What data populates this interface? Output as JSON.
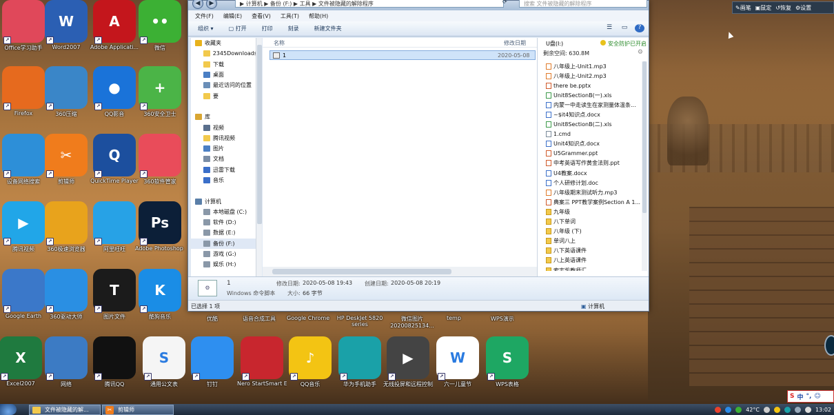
{
  "float_toolbar": {
    "items": [
      "画笔",
      "鼠定",
      "恢复",
      "设置"
    ]
  },
  "desktop_icons": [
    {
      "id": "d1",
      "label": "Office学习助手",
      "icon": "pink-circle-icon",
      "color": "#e0485a",
      "text": ""
    },
    {
      "id": "d2",
      "label": "Word2007",
      "icon": "word-icon",
      "color": "#2b5fb3",
      "text": "W"
    },
    {
      "id": "d3",
      "label": "Adobe Applicati...",
      "icon": "adobe-icon",
      "color": "#c4161c",
      "text": "A"
    },
    {
      "id": "d4",
      "label": "微信",
      "icon": "wechat-icon",
      "color": "#3cb034",
      "text": "••"
    },
    {
      "id": "d5",
      "label": "Firefox",
      "icon": "firefox-icon",
      "color": "#e66a1e",
      "text": ""
    },
    {
      "id": "d6",
      "label": "360压缩",
      "icon": "zip-icon",
      "color": "#3a86c8",
      "text": ""
    },
    {
      "id": "d7",
      "label": "QQ影音",
      "icon": "qq-player-icon",
      "color": "#1a73d9",
      "text": "●"
    },
    {
      "id": "d8",
      "label": "360安全卫士",
      "icon": "360-guard-icon",
      "color": "#4bb447",
      "text": "+"
    },
    {
      "id": "d9",
      "label": "设备网络搜索",
      "icon": "device-search-icon",
      "color": "#2d8fd8",
      "text": ""
    },
    {
      "id": "d10",
      "label": "剪辑师",
      "icon": "scissors-icon",
      "color": "#f07c1c",
      "text": "✂"
    },
    {
      "id": "d11",
      "label": "QuickTime Player",
      "icon": "quicktime-icon",
      "color": "#1c4f9e",
      "text": "Q"
    },
    {
      "id": "d12",
      "label": "360软件管家",
      "icon": "360-software-icon",
      "color": "#e94c5a",
      "text": ""
    },
    {
      "id": "d13",
      "label": "腾讯视频",
      "icon": "tencent-video-icon",
      "color": "#21a6e8",
      "text": "▶"
    },
    {
      "id": "d14",
      "label": "360极速浏览器",
      "icon": "360-browser-icon",
      "color": "#e8a31c",
      "text": ""
    },
    {
      "id": "d15",
      "label": "阿里旺旺",
      "icon": "wangwang-icon",
      "color": "#27a2e6",
      "text": ""
    },
    {
      "id": "d16",
      "label": "Adobe Photoshop ...",
      "icon": "photoshop-icon",
      "color": "#0c1f38",
      "text": "Ps"
    },
    {
      "id": "d17",
      "label": "Google Earth",
      "icon": "google-earth-icon",
      "color": "#3b78c9",
      "text": ""
    },
    {
      "id": "d18",
      "label": "360驱动大师",
      "icon": "driver-icon",
      "color": "#2a8fe3",
      "text": ""
    },
    {
      "id": "d19",
      "label": "图片文件",
      "icon": "t-icon",
      "color": "#1b1b1b",
      "text": "T"
    },
    {
      "id": "d20",
      "label": "酷狗音乐",
      "icon": "kugou-icon",
      "color": "#1a8de6",
      "text": "K"
    }
  ],
  "mid_captions": [
    "优酷",
    "语音合成工具",
    "Google Chrome",
    "HP DeskJet 5820 series",
    "微信图片 20200825134...",
    "temp",
    "WPS演示"
  ],
  "bottom_icons": [
    {
      "id": "b1",
      "label": "Excel2007",
      "icon": "excel-icon",
      "color": "#1f7a3f",
      "text": "X"
    },
    {
      "id": "b2",
      "label": "网络",
      "icon": "network-icon",
      "color": "#3c7bc4",
      "text": ""
    },
    {
      "id": "b3",
      "label": "腾讯QQ",
      "icon": "qq-icon",
      "color": "#111111",
      "text": ""
    },
    {
      "id": "b4",
      "label": "通用公文表",
      "icon": "wps-sheet-icon",
      "color": "#f5f5f5",
      "text": "S"
    },
    {
      "id": "b5",
      "label": "钉钉",
      "icon": "dingtalk-icon",
      "color": "#2e8ff0",
      "text": ""
    },
    {
      "id": "b6",
      "label": "Nero StartSmart Essentials",
      "icon": "nero-icon",
      "color": "#c8262e",
      "text": ""
    },
    {
      "id": "b7",
      "label": "QQ音乐",
      "icon": "qq-music-icon",
      "color": "#f3c413",
      "text": "♪"
    },
    {
      "id": "b8",
      "label": "华为手机助手",
      "icon": "huawei-assistant-icon",
      "color": "#1aa1a8",
      "text": ""
    },
    {
      "id": "b9",
      "label": "无线投屏和远程控制的APP的...",
      "icon": "cast-icon",
      "color": "#444444",
      "text": "▶"
    },
    {
      "id": "b10",
      "label": "六一儿童节",
      "icon": "wps-doc-icon",
      "color": "#ffffff",
      "text": "W"
    },
    {
      "id": "b11",
      "label": "WPS表格",
      "icon": "wps-table-icon",
      "color": "#1ea763",
      "text": "S"
    }
  ],
  "explorer": {
    "address": "▶ 计算机 ▶ 备份 (F:) ▶ 工具 ▶ 文件被隐藏的解除程序",
    "search_placeholder": "搜索 文件被隐藏的解除程序",
    "menu": [
      "文件(F)",
      "编辑(E)",
      "查看(V)",
      "工具(T)",
      "帮助(H)"
    ],
    "commands": [
      "组织 ▾",
      "打开",
      "打印",
      "刻录",
      "新建文件夹"
    ],
    "nav": [
      {
        "label": "收藏夹",
        "group": true,
        "icon": "star-icon",
        "color": "#e8b21c"
      },
      {
        "label": "2345Downloads",
        "group": false,
        "icon": "folder-icon",
        "color": "#f2c94c"
      },
      {
        "label": "下载",
        "group": false,
        "icon": "folder-icon",
        "color": "#f2c94c"
      },
      {
        "label": "桌面",
        "group": false,
        "icon": "desktop-icon",
        "color": "#4b7fc4"
      },
      {
        "label": "最近访问的位置",
        "group": false,
        "icon": "recent-icon",
        "color": "#6b8fb8"
      },
      {
        "label": "要",
        "group": false,
        "icon": "folder-icon",
        "color": "#f2c94c"
      },
      {
        "label": "",
        "group": false,
        "icon": "",
        "color": ""
      },
      {
        "label": "库",
        "group": true,
        "icon": "library-icon",
        "color": "#d9a632"
      },
      {
        "label": "视频",
        "group": false,
        "icon": "video-icon",
        "color": "#5a6f8c"
      },
      {
        "label": "腾讯视频",
        "group": false,
        "icon": "folder-icon",
        "color": "#f2c94c"
      },
      {
        "label": "图片",
        "group": false,
        "icon": "picture-icon",
        "color": "#4b7fc4"
      },
      {
        "label": "文档",
        "group": false,
        "icon": "document-icon",
        "color": "#7a8da6"
      },
      {
        "label": "迅雷下载",
        "group": false,
        "icon": "folder-icon",
        "color": "#3b6fc9"
      },
      {
        "label": "音乐",
        "group": false,
        "icon": "music-icon",
        "color": "#3b6fc9"
      },
      {
        "label": "",
        "group": false,
        "icon": "",
        "color": ""
      },
      {
        "label": "计算机",
        "group": true,
        "icon": "computer-icon",
        "color": "#5a7fa8"
      },
      {
        "label": "本地磁盘 (C:)",
        "group": false,
        "icon": "drive-icon",
        "color": "#8a98a8"
      },
      {
        "label": "软件 (D:)",
        "group": false,
        "icon": "drive-icon",
        "color": "#8a98a8"
      },
      {
        "label": "数据 (E:)",
        "group": false,
        "icon": "drive-icon",
        "color": "#8a98a8"
      },
      {
        "label": "备份 (F:)",
        "group": false,
        "icon": "drive-icon",
        "color": "#8a98a8",
        "selected": true
      },
      {
        "label": "游戏 (G:)",
        "group": false,
        "icon": "drive-icon",
        "color": "#8a98a8"
      },
      {
        "label": "娱乐 (H:)",
        "group": false,
        "icon": "drive-icon",
        "color": "#8a98a8"
      }
    ],
    "columns": {
      "name": "名称",
      "modified": "修改日期"
    },
    "files": [
      {
        "name": "1",
        "modified": "2020-05-08"
      }
    ],
    "usb": {
      "title": "U盘(I:)",
      "badge": "安全防护已开启",
      "space": "剩余空间: 630.8M",
      "items": [
        {
          "name": "八年级上-Unit1.mp3",
          "type": "audio"
        },
        {
          "name": "八年级上-Unit2.mp3",
          "type": "audio"
        },
        {
          "name": "there be.pptx",
          "type": "ppt"
        },
        {
          "name": "Unit8SectionB(一).xls",
          "type": "xls"
        },
        {
          "name": "内蒙一中走读生在家测量体温条...",
          "type": "doc"
        },
        {
          "name": "~$it4知识点.docx",
          "type": "doc"
        },
        {
          "name": "Unit8SectionB(二).xls",
          "type": "xls"
        },
        {
          "name": "1.cmd",
          "type": "cmd"
        },
        {
          "name": "Unit4知识点.docx",
          "type": "doc"
        },
        {
          "name": "U5Grammer.ppt",
          "type": "ppt"
        },
        {
          "name": "中考英语写作黄金法则.ppt",
          "type": "ppt"
        },
        {
          "name": "U4教案.docx",
          "type": "doc"
        },
        {
          "name": "个人研修计划.doc",
          "type": "doc"
        },
        {
          "name": "八年级期末测试听力.mp3",
          "type": "audio"
        },
        {
          "name": "典案三 PPT教学案例Section A 1...",
          "type": "ppt"
        },
        {
          "name": "九年级",
          "type": "folder"
        },
        {
          "name": "八下单词",
          "type": "folder"
        },
        {
          "name": "八年级 (下)",
          "type": "folder"
        },
        {
          "name": "单词八上",
          "type": "folder"
        },
        {
          "name": "八下英语课件",
          "type": "folder"
        },
        {
          "name": "八上英语课件",
          "type": "folder"
        },
        {
          "name": "索志凯教师汇",
          "type": "folder"
        }
      ]
    },
    "details": {
      "name": "1",
      "type": "Windows 命令脚本",
      "modified_label": "修改日期:",
      "modified": "2020-05-08 19:43",
      "created_label": "创建日期:",
      "created": "2020-05-08 20:19",
      "size_label": "大小:",
      "size": "66 字节"
    },
    "status": "已选择 1 项",
    "status_location": "计算机"
  },
  "taskbar": {
    "buttons": [
      {
        "label": "文件被隐藏的解...",
        "icon": "folder-icon"
      },
      {
        "label": "剪辑师",
        "icon": "scissors-icon"
      }
    ],
    "weather": "42°C",
    "time": "13:02"
  },
  "ime": {
    "label": "中"
  }
}
